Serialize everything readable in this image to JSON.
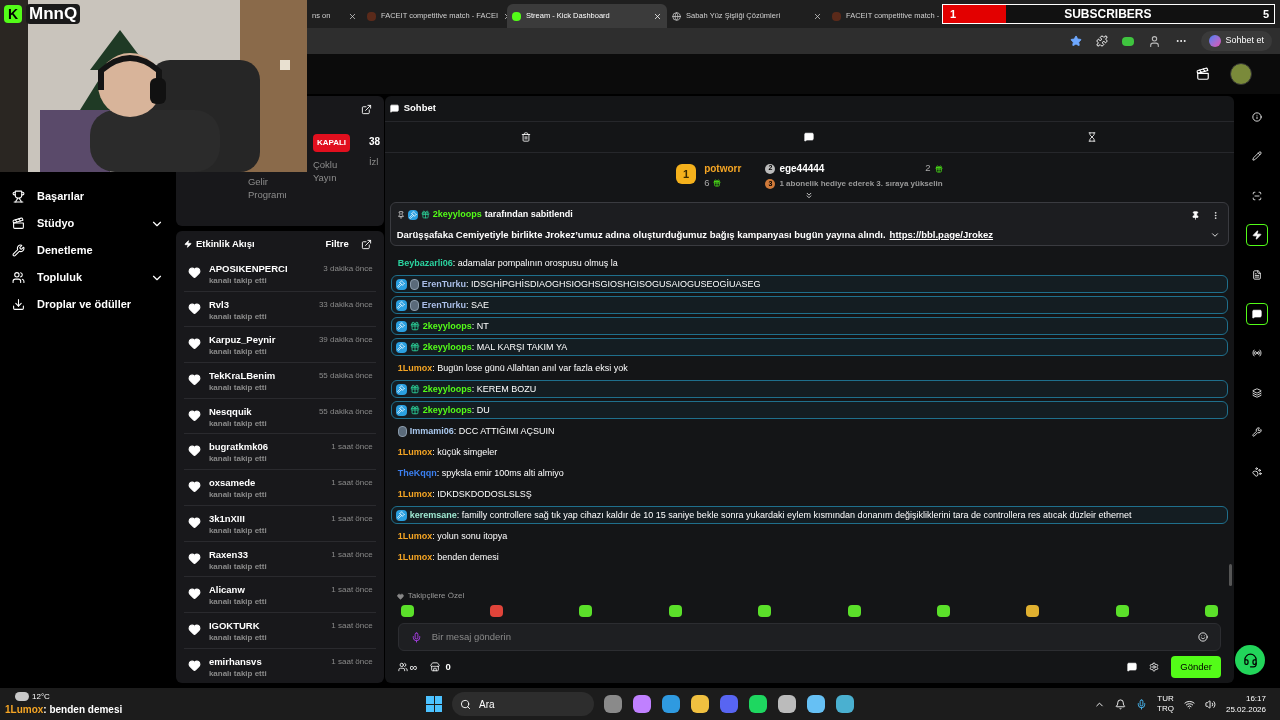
{
  "browser": {
    "tabs": [
      {
        "label": "ns on",
        "selected": false
      },
      {
        "label": "FACEIT competitive match - FACEI",
        "selected": false
      },
      {
        "label": "Stream - Kick Dashboard",
        "selected": true
      },
      {
        "label": "Sabah Yüz Şişliği Çözümleri",
        "selected": false
      },
      {
        "label": "FACEIT competitive match -",
        "selected": false
      }
    ],
    "copilot_button": "Sohbet et"
  },
  "overlay": {
    "logo_mark": "K",
    "channel": "MnnQ",
    "goal": {
      "current": "1",
      "label": "SUBSCRIBERS",
      "target": "5",
      "level": 0.19
    },
    "last_chat": {
      "user": "1Lumox",
      "text": ": benden demesi"
    }
  },
  "sidebar": {
    "items": [
      {
        "label": "Başarılar",
        "expandable": false
      },
      {
        "label": "Stüdyo",
        "expandable": true
      },
      {
        "label": "Denetleme",
        "expandable": false
      },
      {
        "label": "Topluluk",
        "expandable": true
      },
      {
        "label": "Droplar ve ödüller",
        "expandable": false
      }
    ]
  },
  "stream_card": {
    "status": "KAPALI",
    "viewers": "38",
    "viewers_label": "İzl",
    "multistream": "Çoklu Yayın",
    "revenue": "Gelir Programı"
  },
  "activity": {
    "title": "Etkinlik Akışı",
    "filter": "Filtre",
    "items": [
      {
        "user": "APOSIKENPERCI",
        "action": "kanalı takip etti",
        "time": "3 dakika önce"
      },
      {
        "user": "Rvl3",
        "action": "kanalı takip etti",
        "time": "33 dakika önce"
      },
      {
        "user": "Karpuz_Peynir",
        "action": "kanalı takip etti",
        "time": "39 dakika önce"
      },
      {
        "user": "TekKraLBenim",
        "action": "kanalı takip etti",
        "time": "55 dakika önce"
      },
      {
        "user": "Nesqquik",
        "action": "kanalı takip etti",
        "time": "55 dakika önce"
      },
      {
        "user": "bugratkmk06",
        "action": "kanalı takip etti",
        "time": "1 saat önce"
      },
      {
        "user": "oxsamede",
        "action": "kanalı takip etti",
        "time": "1 saat önce"
      },
      {
        "user": "3k1nXIII",
        "action": "kanalı takip etti",
        "time": "1 saat önce"
      },
      {
        "user": "Raxen33",
        "action": "kanalı takip etti",
        "time": "1 saat önce"
      },
      {
        "user": "Alicanw",
        "action": "kanalı takip etti",
        "time": "1 saat önce"
      },
      {
        "user": "IGOKTURK",
        "action": "kanalı takip etti",
        "time": "1 saat önce"
      },
      {
        "user": "emirhansvs",
        "action": "kanalı takip etti",
        "time": "1 saat önce"
      }
    ]
  },
  "chat": {
    "title": "Sohbet",
    "leaderboard": [
      {
        "rank": "1",
        "user": "potworr",
        "count": "6"
      },
      {
        "rank": "2",
        "user": "ege44444",
        "count": "2"
      },
      {
        "rank": "3",
        "hint": "1 abonelik hediye ederek 3. sıraya yükselin"
      }
    ],
    "pinned": {
      "user": "2keyyloops",
      "by": "tarafından sabitlendi",
      "text": "Darüşşafaka Cemiyetiyle birlikte Jrokez’umuz adına oluşturduğumuz bağış kampanyası bugün yayına alındı.",
      "link": "https://bbl.page/Jrokez"
    },
    "messages": [
      {
        "highlighted": false,
        "moderator": false,
        "subscriber": false,
        "user_badge": false,
        "user": "Beybazarli06",
        "color": "#2bd4a0",
        "text": ": adamalar pompalının orospusu olmuş la"
      },
      {
        "highlighted": true,
        "moderator": true,
        "subscriber": false,
        "user_badge": true,
        "user": "ErenTurku",
        "color": "#a9bde6",
        "text": ": IDSGHİPGHİSDIAOGHSIOGHSGIOSHGISOGUSAIOGUSEOGİUASEG"
      },
      {
        "highlighted": true,
        "moderator": true,
        "subscriber": false,
        "user_badge": true,
        "user": "ErenTurku",
        "color": "#a9bde6",
        "text": ": SAE"
      },
      {
        "highlighted": true,
        "moderator": true,
        "subscriber": true,
        "user_badge": false,
        "user": "2keyyloops",
        "color": "#53fc18",
        "text": ": NT"
      },
      {
        "highlighted": true,
        "moderator": true,
        "subscriber": true,
        "user_badge": false,
        "user": "2keyyloops",
        "color": "#53fc18",
        "text": ": MAL KARŞI TAKIM YA"
      },
      {
        "highlighted": false,
        "moderator": false,
        "subscriber": false,
        "user_badge": false,
        "user": "1Lumox",
        "color": "#f5a524",
        "text": ": Bugün lose günü Allahtan anıl var fazla eksi yok"
      },
      {
        "highlighted": true,
        "moderator": true,
        "subscriber": true,
        "user_badge": false,
        "user": "2keyyloops",
        "color": "#53fc18",
        "text": ": KEREM BOZU"
      },
      {
        "highlighted": true,
        "moderator": true,
        "subscriber": true,
        "user_badge": false,
        "user": "2keyyloops",
        "color": "#53fc18",
        "text": ": DU"
      },
      {
        "highlighted": false,
        "moderator": false,
        "subscriber": false,
        "user_badge": true,
        "user": "Immami06",
        "color": "#a9c8ee",
        "text": ": DCC ATTIĞIMI AÇSUIN"
      },
      {
        "highlighted": false,
        "moderator": false,
        "subscriber": false,
        "user_badge": false,
        "user": "1Lumox",
        "color": "#f5a524",
        "text": ": küçük simgeler"
      },
      {
        "highlighted": false,
        "moderator": false,
        "subscriber": false,
        "user_badge": false,
        "user": "TheKqqn",
        "color": "#3b7ff0",
        "text": ": spyksla emir 100ms alti almiyo"
      },
      {
        "highlighted": false,
        "moderator": false,
        "subscriber": false,
        "user_badge": false,
        "user": "1Lumox",
        "color": "#f5a524",
        "text": ": IDKDSKDODOSLSLSŞ"
      },
      {
        "highlighted": true,
        "moderator": true,
        "subscriber": false,
        "user_badge": false,
        "user": "keremsane",
        "color": "#9fe8d2",
        "text": ": familly controllere sağ tık yap cihazı kaldır de 10 15 saniye bekle sonra yukardaki eylem kısmından donanım değişikliklerini tara de controllera res atıcak düzleir ethernet"
      },
      {
        "highlighted": false,
        "moderator": false,
        "subscriber": false,
        "user_badge": false,
        "user": "1Lumox",
        "color": "#f5a524",
        "text": ": yolun sonu itopya"
      },
      {
        "highlighted": false,
        "moderator": false,
        "subscriber": false,
        "user_badge": false,
        "user": "1Lumox",
        "color": "#f5a524",
        "text": ": benden demesi"
      }
    ],
    "emote_label": "Takipçilere Özel",
    "placeholder": "Bir mesaj gönderin",
    "points_symbol": "∞",
    "points": "0",
    "send": "Gönder"
  },
  "right_rail": [
    {
      "active": false
    },
    {
      "active": false
    },
    {
      "active": false
    },
    {
      "active": true
    },
    {
      "active": false
    },
    {
      "active": true
    },
    {
      "active": false
    },
    {
      "active": false
    },
    {
      "active": false
    },
    {
      "active": false
    }
  ],
  "taskbar": {
    "weather": "12°C",
    "search": "Ara",
    "lang_top": "TUR",
    "lang_bottom": "TRQ",
    "time": "16:17",
    "date": "25.02.2026"
  }
}
